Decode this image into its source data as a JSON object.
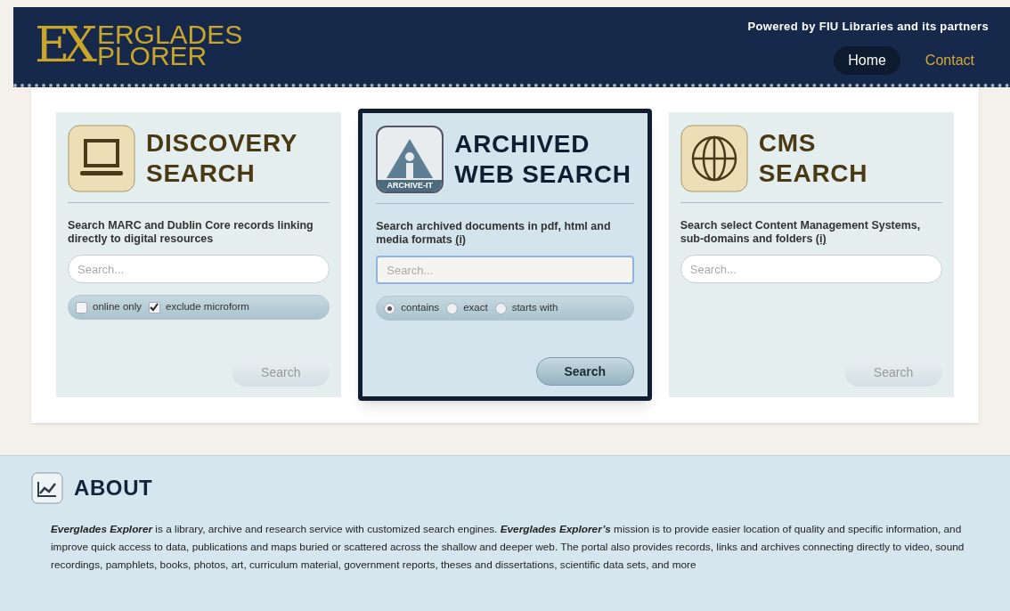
{
  "header": {
    "logo": {
      "monogram": "EX",
      "line1": "ERGLADES",
      "line2": "PLORER"
    },
    "tagline": "Powered by FIU Libraries and its partners",
    "nav": [
      {
        "label": "Home",
        "selected": true
      },
      {
        "label": "Contact",
        "selected": false
      }
    ]
  },
  "cards": [
    {
      "title_lines": [
        "DISCOVERY",
        "SEARCH"
      ],
      "selected": false,
      "description": "Search MARC and Dublin Core records linking directly to digital resources",
      "placeholder": "Search...",
      "focused": false,
      "options": [
        {
          "kind": "checkbox",
          "label": "online only",
          "checked": false
        },
        {
          "kind": "checkbox",
          "label": "exclude microform",
          "checked": true
        }
      ],
      "button": {
        "label": "Search",
        "disabled": true
      }
    },
    {
      "icon_label": "ARCHIVE-IT",
      "title_lines": [
        "ARCHIVED",
        "WEB SEARCH"
      ],
      "selected": true,
      "description": "Search archived documents in pdf, html and media formats",
      "info_link": "(i)",
      "placeholder": "Search...",
      "focused": true,
      "options": [
        {
          "kind": "radio",
          "label": "contains",
          "checked": true
        },
        {
          "kind": "radio",
          "label": "exact",
          "checked": false
        },
        {
          "kind": "radio",
          "label": "starts with",
          "checked": false
        }
      ],
      "button": {
        "label": "Search",
        "disabled": false
      }
    },
    {
      "title_lines": [
        "CMS",
        "SEARCH"
      ],
      "selected": false,
      "description": "Search select Content Management Systems, sub-domains and folders",
      "info_link": "(i)",
      "placeholder": "Search...",
      "focused": false,
      "button": {
        "label": "Search",
        "disabled": true
      }
    }
  ],
  "about": {
    "title": "ABOUT",
    "text": "**Everglades Explorer** is a library, archive and research service with customized search engines. **Everglades Explorer’s** mission is to provide easier location of quality and specific information, and improve quick access to data, publications and maps buried or scattered across the shallow and deeper web. The portal also provides records, links and archives connecting directly to video, sound recordings, pamphlets, books, photos, art, curriculum material, government reports, theses and dissertations, scientific data sets, and more"
  }
}
